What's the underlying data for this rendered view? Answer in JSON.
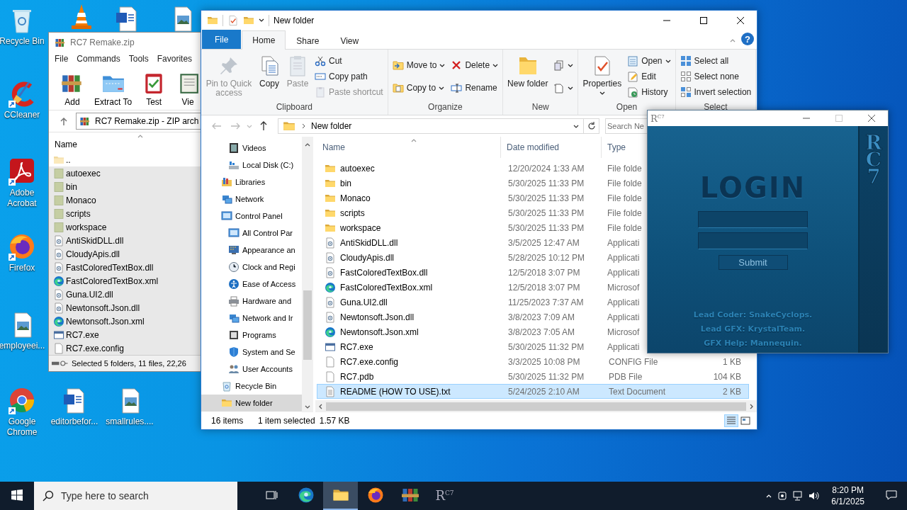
{
  "desktop_icons": [
    {
      "label": "Recycle Bin",
      "kind": "recycle"
    },
    {
      "kind": "cone"
    },
    {
      "kind": "word"
    },
    {
      "kind": "image"
    },
    {
      "label": "CCleaner",
      "kind": "ccleaner"
    },
    {
      "label": "Adobe Acrobat",
      "kind": "acrobat"
    },
    {
      "label": "Firefox",
      "kind": "firefox"
    },
    {
      "label": "employeei...",
      "kind": "image"
    },
    {
      "label": "Google Chrome",
      "kind": "chrome"
    },
    {
      "label": "editorbefor...",
      "kind": "word"
    },
    {
      "label": "smallrules....",
      "kind": "image"
    }
  ],
  "winrar": {
    "title": "RC7 Remake.zip",
    "menu": [
      "File",
      "Commands",
      "Tools",
      "Favorites"
    ],
    "toolbar": [
      {
        "label": "Add",
        "kind": "add"
      },
      {
        "label": "Extract To",
        "kind": "extract"
      },
      {
        "label": "Test",
        "kind": "test"
      },
      {
        "label": "Vie",
        "kind": "view"
      }
    ],
    "address": "RC7 Remake.zip - ZIP arch",
    "column": "Name",
    "rows": [
      {
        "name": "..",
        "kind": "up",
        "selected": false
      },
      {
        "name": "autoexec",
        "kind": "folder",
        "selected": true
      },
      {
        "name": "bin",
        "kind": "folder",
        "selected": true
      },
      {
        "name": "Monaco",
        "kind": "folder",
        "selected": true
      },
      {
        "name": "scripts",
        "kind": "folder",
        "selected": true
      },
      {
        "name": "workspace",
        "kind": "folder",
        "selected": true
      },
      {
        "name": "AntiSkidDLL.dll",
        "kind": "dll",
        "selected": true
      },
      {
        "name": "CloudyApis.dll",
        "kind": "dll",
        "selected": true
      },
      {
        "name": "FastColoredTextBox.dll",
        "kind": "dll",
        "selected": true
      },
      {
        "name": "FastColoredTextBox.xml",
        "kind": "edge",
        "selected": true
      },
      {
        "name": "Guna.UI2.dll",
        "kind": "dll",
        "selected": true
      },
      {
        "name": "Newtonsoft.Json.dll",
        "kind": "dll",
        "selected": true
      },
      {
        "name": "Newtonsoft.Json.xml",
        "kind": "edge",
        "selected": true
      },
      {
        "name": "RC7.exe",
        "kind": "exe",
        "selected": true
      },
      {
        "name": "RC7.exe.config",
        "kind": "file",
        "selected": true
      }
    ],
    "status": "Selected 5 folders, 11 files, 22,26"
  },
  "explorer": {
    "title": "New folder",
    "ribbon_tabs": [
      {
        "label": "File",
        "kind": "file",
        "selected": false
      },
      {
        "label": "Home",
        "kind": "tab",
        "selected": true
      },
      {
        "label": "Share",
        "kind": "tab",
        "selected": false
      },
      {
        "label": "View",
        "kind": "tab",
        "selected": false
      }
    ],
    "help": "?",
    "ribbon_groups": [
      {
        "label": "Clipboard",
        "items": [
          {
            "kind": "large",
            "label": "Pin to Quick access",
            "disabled": true,
            "dropdown": false
          },
          {
            "kind": "large",
            "label": "Copy",
            "disabled": false,
            "dropdown": false
          },
          {
            "kind": "large",
            "label": "Paste",
            "disabled": true,
            "dropdown": false
          },
          {
            "kind": "stack",
            "commands": [
              {
                "label": "Cut",
                "disabled": false,
                "dropdown": false
              },
              {
                "label": "Copy path",
                "disabled": false,
                "dropdown": false
              },
              {
                "label": "Paste shortcut",
                "disabled": true,
                "dropdown": false
              }
            ]
          }
        ]
      },
      {
        "label": "Organize",
        "items": [
          {
            "kind": "stack",
            "commands": [
              {
                "label": "Move to",
                "disabled": false,
                "dropdown": true
              },
              {
                "label": "Copy to",
                "disabled": false,
                "dropdown": true
              }
            ]
          },
          {
            "kind": "stack",
            "commands": [
              {
                "label": "Delete",
                "disabled": false,
                "dropdown": true
              },
              {
                "label": "Rename",
                "disabled": false,
                "dropdown": false
              }
            ]
          }
        ]
      },
      {
        "label": "New",
        "items": [
          {
            "kind": "large",
            "label": "New folder",
            "disabled": false,
            "dropdown": false
          },
          {
            "kind": "stack",
            "commands": [
              {
                "disabled": false,
                "dropdown": true
              },
              {
                "disabled": false,
                "dropdown": true
              }
            ]
          }
        ]
      },
      {
        "label": "Open",
        "items": [
          {
            "kind": "large",
            "label": "Properties",
            "disabled": false,
            "dropdown": true
          },
          {
            "kind": "stack",
            "commands": [
              {
                "label": "Open",
                "disabled": false,
                "dropdown": true
              },
              {
                "label": "Edit",
                "disabled": false,
                "dropdown": false
              },
              {
                "label": "History",
                "disabled": false,
                "dropdown": false
              }
            ]
          }
        ]
      },
      {
        "label": "Select",
        "items": [
          {
            "kind": "stack",
            "commands": [
              {
                "label": "Select all",
                "disabled": false,
                "dropdown": false
              },
              {
                "label": "Select none",
                "disabled": false,
                "dropdown": false
              },
              {
                "label": "Invert selection",
                "disabled": false,
                "dropdown": false
              }
            ]
          }
        ]
      }
    ],
    "address": "New folder",
    "search_placeholder": "Search Ne",
    "nav_pane": {
      "items": [
        {
          "children": [
            {
              "label": "Videos",
              "kind": "videos",
              "selected": false
            },
            {
              "label": "Local Disk (C:)",
              "kind": "disk",
              "selected": false
            }
          ]
        },
        {
          "label": "Libraries",
          "kind": "libraries",
          "selected": false
        },
        {
          "label": "Network",
          "kind": "network",
          "selected": false
        },
        {
          "label": "Control Panel",
          "kind": "control",
          "selected": false,
          "children": [
            {
              "label": "All Control Par",
              "kind": "control",
              "selected": false
            },
            {
              "label": "Appearance an",
              "kind": "appearance",
              "selected": false
            },
            {
              "label": "Clock and Regi",
              "kind": "clock",
              "selected": false
            },
            {
              "label": "Ease of Access",
              "kind": "ease",
              "selected": false
            },
            {
              "label": "Hardware and",
              "kind": "hardware",
              "selected": false
            },
            {
              "label": "Network and Ir",
              "kind": "network",
              "selected": false
            },
            {
              "label": "Programs",
              "kind": "programs",
              "selected": false
            },
            {
              "label": "System and Se",
              "kind": "system",
              "selected": false
            },
            {
              "label": "User Accounts",
              "kind": "users",
              "selected": false
            }
          ]
        },
        {
          "label": "Recycle Bin",
          "kind": "recycle",
          "selected": false
        },
        {
          "label": "New folder",
          "kind": "folder",
          "selected": true
        }
      ]
    },
    "columns": [
      "Name",
      "Date modified",
      "Type"
    ],
    "rows": [
      {
        "name": "autoexec",
        "date": "12/20/2024 1:33 AM",
        "type": "File folde",
        "kind": "folder",
        "selected": false
      },
      {
        "name": "bin",
        "date": "5/30/2025 11:33 PM",
        "type": "File folde",
        "kind": "folder",
        "selected": false
      },
      {
        "name": "Monaco",
        "date": "5/30/2025 11:33 PM",
        "type": "File folde",
        "kind": "folder",
        "selected": false
      },
      {
        "name": "scripts",
        "date": "5/30/2025 11:33 PM",
        "type": "File folde",
        "kind": "folder",
        "selected": false
      },
      {
        "name": "workspace",
        "date": "5/30/2025 11:33 PM",
        "type": "File folde",
        "kind": "folder",
        "selected": false
      },
      {
        "name": "AntiSkidDLL.dll",
        "date": "3/5/2025 12:47 AM",
        "type": "Applicati",
        "kind": "dll",
        "selected": false
      },
      {
        "name": "CloudyApis.dll",
        "date": "5/28/2025 10:12 PM",
        "type": "Applicati",
        "kind": "dll",
        "selected": false
      },
      {
        "name": "FastColoredTextBox.dll",
        "date": "12/5/2018 3:07 PM",
        "type": "Applicati",
        "kind": "dll",
        "selected": false
      },
      {
        "name": "FastColoredTextBox.xml",
        "date": "12/5/2018 3:07 PM",
        "type": "Microsof",
        "kind": "edge",
        "selected": false
      },
      {
        "name": "Guna.UI2.dll",
        "date": "11/25/2023 7:37 AM",
        "type": "Applicati",
        "kind": "dll",
        "selected": false
      },
      {
        "name": "Newtonsoft.Json.dll",
        "date": "3/8/2023 7:09 AM",
        "type": "Applicati",
        "kind": "dll",
        "selected": false
      },
      {
        "name": "Newtonsoft.Json.xml",
        "date": "3/8/2023 7:05 AM",
        "type": "Microsof",
        "kind": "edge",
        "selected": false
      },
      {
        "name": "RC7.exe",
        "date": "5/30/2025 11:32 PM",
        "type": "Applicati",
        "kind": "exe",
        "selected": false
      },
      {
        "name": "RC7.exe.config",
        "date": "3/3/2025 10:08 PM",
        "type": "CONFIG File",
        "size": "1 KB",
        "kind": "file",
        "selected": false
      },
      {
        "name": "RC7.pdb",
        "date": "5/30/2025 11:32 PM",
        "type": "PDB File",
        "size": "104 KB",
        "kind": "file",
        "selected": false
      },
      {
        "name": "README (HOW TO USE).txt",
        "date": "5/24/2025 2:10 AM",
        "type": "Text Document",
        "size": "2 KB",
        "kind": "txt",
        "selected": true
      }
    ],
    "status": {
      "count": "16 items",
      "selection": "1 item selected",
      "size": "1.57 KB"
    },
    "views": [
      {
        "kind": "details",
        "selected": true
      },
      {
        "kind": "tiles",
        "selected": false
      }
    ]
  },
  "rc7": {
    "title_logo": "R$^{C7}$",
    "heading": "LOGIN",
    "submit": "Submit",
    "credits": [
      "Lead Coder: SnakeCyclops.",
      "Lead GFX: KrystalTeam.",
      "GFX Help: Mannequin."
    ],
    "side_logo": "RC7"
  },
  "taskbar": {
    "search_placeholder": "Type here to search",
    "apps": [
      {
        "kind": "edge",
        "selected": false
      },
      {
        "kind": "explorer",
        "selected": true
      },
      {
        "kind": "firefox",
        "selected": false
      },
      {
        "kind": "winrar",
        "selected": false
      },
      {
        "kind": "rc7",
        "label": "R$^{C7}$",
        "selected": false
      }
    ],
    "time": "8:20 PM",
    "date": "6/1/2025"
  }
}
